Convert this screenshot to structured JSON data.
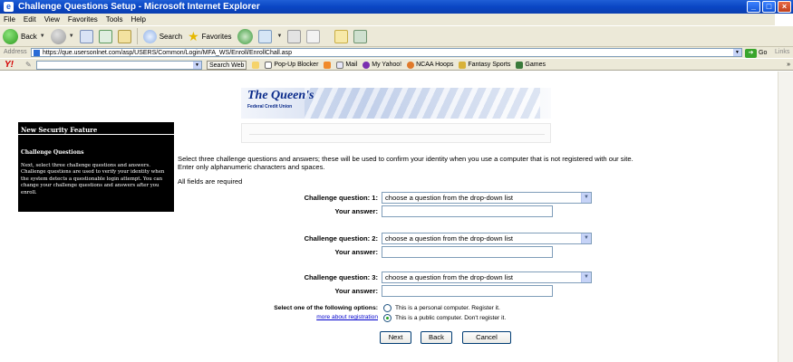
{
  "window": {
    "title": "Challenge Questions Setup - Microsoft Internet Explorer",
    "controls": [
      "_",
      "□",
      "×"
    ]
  },
  "menu": [
    "File",
    "Edit",
    "View",
    "Favorites",
    "Tools",
    "Help"
  ],
  "toolbar": {
    "back": "Back",
    "search": "Search",
    "favorites": "Favorites"
  },
  "address": {
    "label": "Address",
    "url": "https://que.usersonlnet.com/asp/USERS/Common/Login/MFA_WS/Enroll/EnrollChall.asp",
    "go": "Go",
    "links": "Links"
  },
  "yahoo": {
    "logo": "Y!",
    "search_web": "Search Web",
    "popup_blocker": "Pop-Up Blocker",
    "mail": "Mail",
    "my_yahoo": "My Yahoo!",
    "ncaa": "NCAA Hoops",
    "fantasy": "Fantasy Sports",
    "games": "Games",
    "more": "»"
  },
  "logo": {
    "name": "The Queen's",
    "sub": "Federal Credit Union"
  },
  "sidebar": {
    "header": "New Security Feature",
    "title": "Challenge Questions",
    "body": "Next, select three challenge questions and answers. Challenge questions are used to verify your identity when the system detects a questionable login attempt. You can change your challenge questions and answers after you enroll."
  },
  "form": {
    "intro": "Select three challenge questions and answers; these will be used to confirm your identity when you use a computer that is not registered with our site. Enter only alphanumeric characters and spaces.",
    "required": "All fields are required",
    "questions": [
      {
        "label": "Challenge question: 1:",
        "placeholder": "choose a question from the drop-down list",
        "answer_label": "Your answer:"
      },
      {
        "label": "Challenge question: 2:",
        "placeholder": "choose a question from the drop-down list",
        "answer_label": "Your answer:"
      },
      {
        "label": "Challenge question: 3:",
        "placeholder": "choose a question from the drop-down list",
        "answer_label": "Your answer:"
      }
    ],
    "options_label": "Select one of the following options:",
    "more_link": "more about registration",
    "option_personal": "This is a personal computer. Register it.",
    "option_public": "This is a public computer. Don't register it.",
    "selected_option": "public",
    "buttons": {
      "next": "Next",
      "back": "Back",
      "cancel": "Cancel"
    }
  }
}
